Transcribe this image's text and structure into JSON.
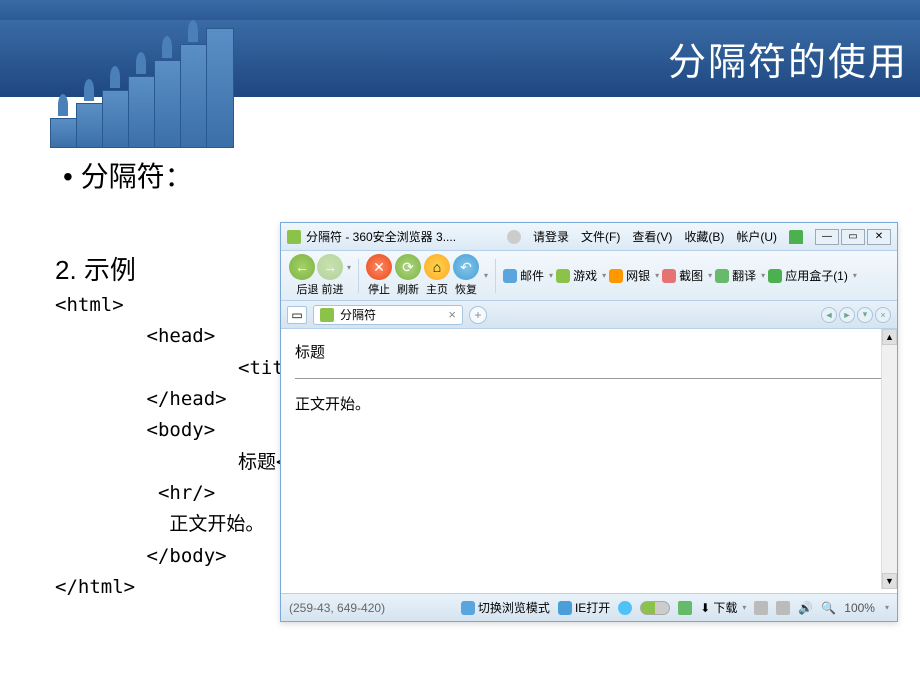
{
  "slide": {
    "header_title": "分隔符的使用",
    "bullet_label": "•  分隔符：",
    "section_title": "2. 示例",
    "code_lines": "<html>\n        <head>\n                <title\n        </head>\n        <body>\n                标题<b\n         <hr/>\n          正文开始。\n        </body>\n</html>"
  },
  "browser": {
    "title": "分隔符 - 360安全浏览器 3....",
    "login_text": "请登录",
    "menus": {
      "file": "文件(F)",
      "view": "查看(V)",
      "favorites": "收藏(B)",
      "account": "帐户(U)"
    },
    "nav": {
      "back": "后退",
      "forward": "前进",
      "stop": "停止",
      "refresh": "刷新",
      "home": "主页",
      "restore": "恢复"
    },
    "links": {
      "mail": "邮件",
      "game": "游戏",
      "bank": "网银",
      "capture": "截图",
      "translate": "翻译",
      "appbox": "应用盒子(1)"
    },
    "tab": {
      "title": "分隔符"
    },
    "content": {
      "heading": "标题",
      "body": "正文开始。"
    },
    "status": {
      "coords": "(259-43, 649-420)",
      "switch_mode": "切换浏览模式",
      "ie_open": "IE打开",
      "download": "下载",
      "zoom": "100%"
    }
  }
}
